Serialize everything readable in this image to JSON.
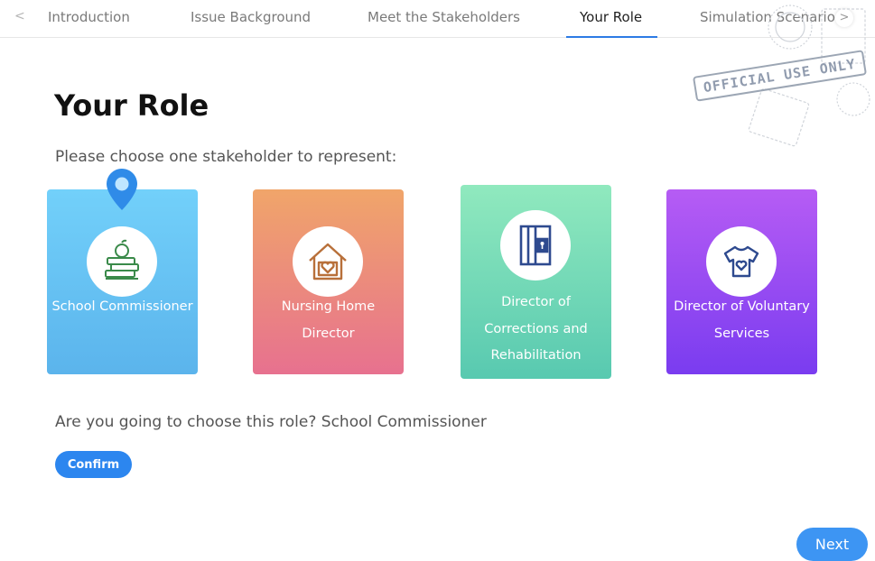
{
  "tabs": [
    {
      "label": "Introduction",
      "active": false
    },
    {
      "label": "Issue Background",
      "active": false
    },
    {
      "label": "Meet the Stakeholders",
      "active": false
    },
    {
      "label": "Your Role",
      "active": true
    },
    {
      "label": "Simulation Scenario",
      "active": false
    }
  ],
  "tab_nav": {
    "prev_icon": "chevron-left-icon",
    "next_icon": "chevron-right-icon"
  },
  "stamp": {
    "text": "OFFICIAL USE ONLY"
  },
  "page": {
    "title": "Your Role",
    "prompt": "Please choose one stakeholder to represent:"
  },
  "roles": [
    {
      "label_lines": [
        "School Commissioner"
      ],
      "icon": "books-apple-icon",
      "selected": true,
      "colors": [
        "#72d0fa",
        "#5bb4ec"
      ]
    },
    {
      "label_lines": [
        "Nursing Home",
        "Director"
      ],
      "icon": "house-heart-icon",
      "selected": false,
      "colors": [
        "#f0a56a",
        "#e7718f"
      ]
    },
    {
      "label_lines": [
        "Director of",
        "Corrections and",
        "Rehabilitation"
      ],
      "icon": "jail-door-icon",
      "selected": false,
      "colors": [
        "#90e9be",
        "#58c9b0"
      ]
    },
    {
      "label_lines": [
        "Director of Voluntary",
        "Services"
      ],
      "icon": "tshirt-heart-icon",
      "selected": false,
      "colors": [
        "#b65cf4",
        "#7a3cf0"
      ]
    }
  ],
  "selection": {
    "question": "Are you going to choose this role? School Commissioner",
    "confirm_label": "Confirm"
  },
  "footer": {
    "next_label": "Next"
  },
  "colors": {
    "accent": "#2c86ef",
    "tab_underline": "#2c7be5"
  }
}
